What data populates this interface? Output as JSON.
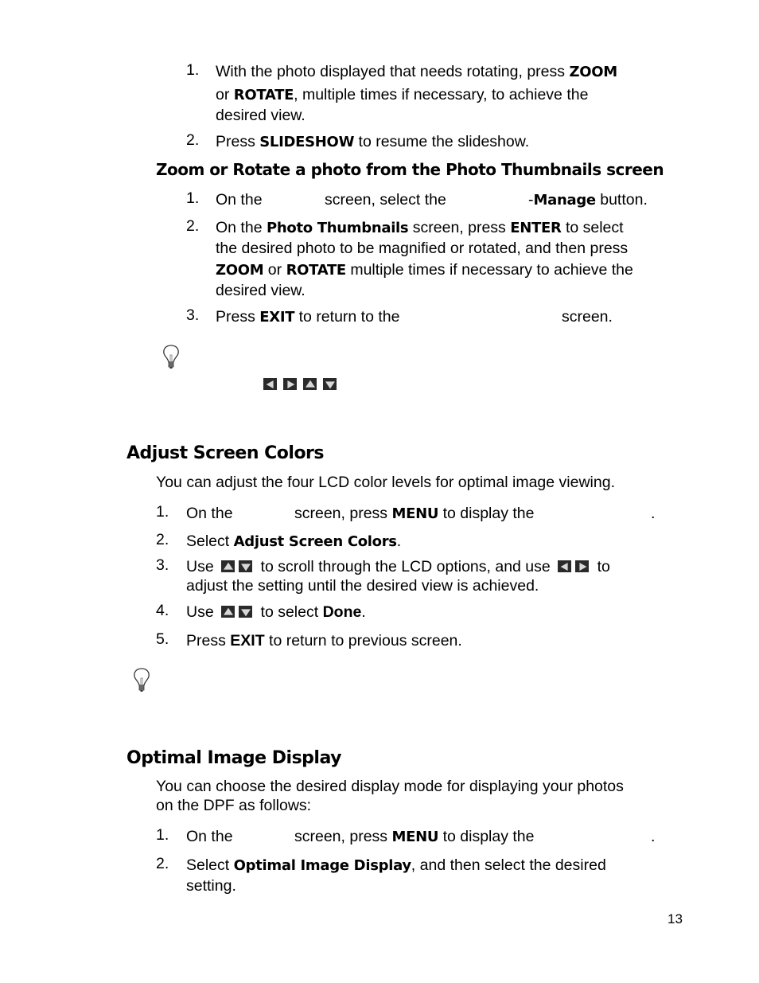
{
  "section_zoom_slideshow": {
    "steps": [
      {
        "num": "1.",
        "lines": [
          {
            "pre": "With the photo displayed that needs rotating, press ",
            "bold": "ZOOM",
            "post": ""
          },
          {
            "pre": "or ",
            "bold": "ROTATE",
            "post": ", multiple times if necessary, to achieve the"
          },
          {
            "pre": "desired view.",
            "bold": "",
            "post": ""
          }
        ]
      },
      {
        "num": "2.",
        "lines": [
          {
            "pre": "Press ",
            "bold": "SLIDESHOW",
            "post": " to resume the slideshow."
          }
        ]
      }
    ]
  },
  "section_thumbnails": {
    "heading": "Zoom or Rotate a photo from the Photo Thumbnails screen",
    "steps": [
      {
        "num": "1.",
        "a": "On the",
        "b": "screen, select the",
        "c": "-",
        "bold": "Manage",
        "d": " button."
      },
      {
        "num": "2.",
        "lines": [
          {
            "pre": "On the ",
            "bold": "Photo Thumbnails",
            "mid": " screen, press ",
            "bold2": "ENTER",
            "post": " to select"
          },
          {
            "text": "the desired photo to be magnified or rotated, and then press"
          },
          {
            "bold": "ZOOM",
            "mid": " or ",
            "bold2": "ROTATE",
            "post": " multiple times if necessary to achieve the"
          },
          {
            "text": "desired view."
          }
        ]
      },
      {
        "num": "3.",
        "pre": "Press ",
        "bold": "EXIT",
        "post": " to return to the",
        "tail": "screen."
      }
    ],
    "tip_icons": [
      "arrow-left-key",
      "arrow-right-key",
      "arrow-up-key",
      "arrow-down-key"
    ]
  },
  "section_colors": {
    "heading": "Adjust Screen Colors",
    "intro": "You can adjust the four LCD color levels for optimal image viewing.",
    "steps": [
      {
        "num": "1.",
        "a": "On the",
        "b": "screen, press ",
        "bold": "MENU",
        "c": " to display the",
        "d": "."
      },
      {
        "num": "2.",
        "pre": "Select ",
        "bold": "Adjust Screen Colors",
        "post": "."
      },
      {
        "num": "3.",
        "a": "Use",
        "b": "to scroll through the LCD options, and use",
        "c": "to",
        "line2": "adjust the setting until the desired view is achieved."
      },
      {
        "num": "4.",
        "a": "Use",
        "b": "to select ",
        "bold": "Done",
        "post": "."
      },
      {
        "num": "5.",
        "pre": "Press ",
        "bold": "EXIT",
        "post": " to return to previous screen."
      }
    ]
  },
  "section_display": {
    "heading": "Optimal Image Display",
    "intro_lines": [
      "You can choose the desired display mode for displaying your photos",
      "on the DPF as follows:"
    ],
    "steps": [
      {
        "num": "1.",
        "a": "On the",
        "b": "screen, press ",
        "bold": "MENU",
        "c": " to display the",
        "d": "."
      },
      {
        "num": "2.",
        "pre": "Select ",
        "bold": "Optimal Image Display",
        "post": ", and then select the desired",
        "line2": "setting."
      }
    ]
  },
  "page_number": "13"
}
